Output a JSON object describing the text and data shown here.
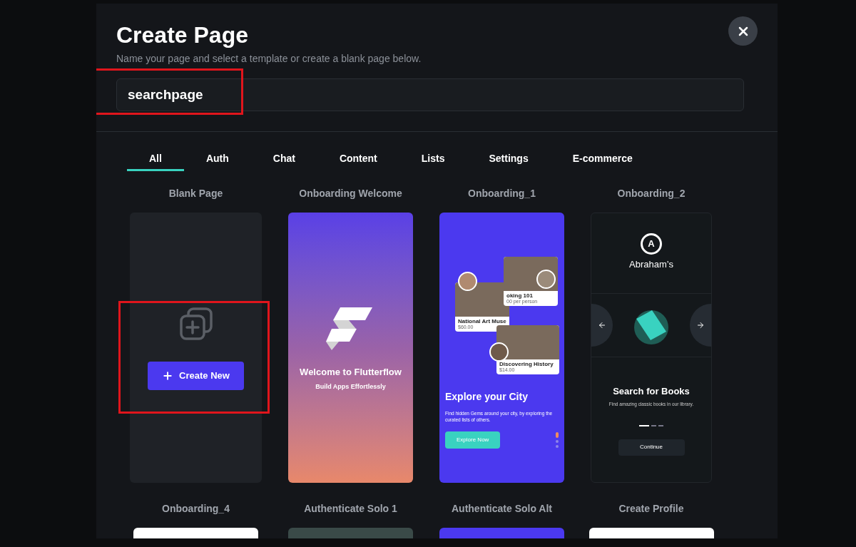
{
  "dialog": {
    "title": "Create Page",
    "subtitle": "Name your page and select a template or create a blank page below.",
    "page_name": {
      "value": "searchpage"
    }
  },
  "tabs": [
    {
      "label": "All",
      "selected": true
    },
    {
      "label": "Auth",
      "selected": false
    },
    {
      "label": "Chat",
      "selected": false
    },
    {
      "label": "Content",
      "selected": false
    },
    {
      "label": "Lists",
      "selected": false
    },
    {
      "label": "Settings",
      "selected": false
    },
    {
      "label": "E-commerce",
      "selected": false
    }
  ],
  "templates": [
    {
      "label": "Blank Page",
      "kind": "blank",
      "button": "Create New"
    },
    {
      "label": "Onboarding Welcome",
      "kind": "welcome",
      "title": "Welcome to Flutterflow",
      "subtitle": "Build Apps Effortlessly"
    },
    {
      "label": "Onboarding_1",
      "kind": "explore",
      "cards": [
        {
          "title": "National Art Muse",
          "price": "$60.00"
        },
        {
          "title": "oking 101",
          "price": "00 per person"
        },
        {
          "title": "Discovering History",
          "price": "$14.00"
        }
      ],
      "title": "Explore your City",
      "subtitle": "Find hidden Gems around your city, by exploring the curated lists of others.",
      "button": "Explore Now",
      "dots": [
        {
          "selected": true
        },
        {
          "selected": false
        },
        {
          "selected": false
        }
      ]
    },
    {
      "label": "Onboarding_2",
      "kind": "books",
      "logo_letter": "A",
      "brand": "Abraham’s",
      "title": "Search for Books",
      "subtitle": "Find amazing classic books in our library.",
      "dots": [
        {
          "selected": true
        },
        {
          "selected": false
        },
        {
          "selected": false
        }
      ],
      "button": "Continue"
    }
  ],
  "more_templates": [
    {
      "label": "Onboarding_4",
      "color": "#ffffff"
    },
    {
      "label": "Authenticate Solo 1",
      "color": "#3a4a48"
    },
    {
      "label": "Authenticate Solo Alt",
      "color": "#4b39ef"
    },
    {
      "label": "Create Profile",
      "color": "#ffffff"
    }
  ]
}
